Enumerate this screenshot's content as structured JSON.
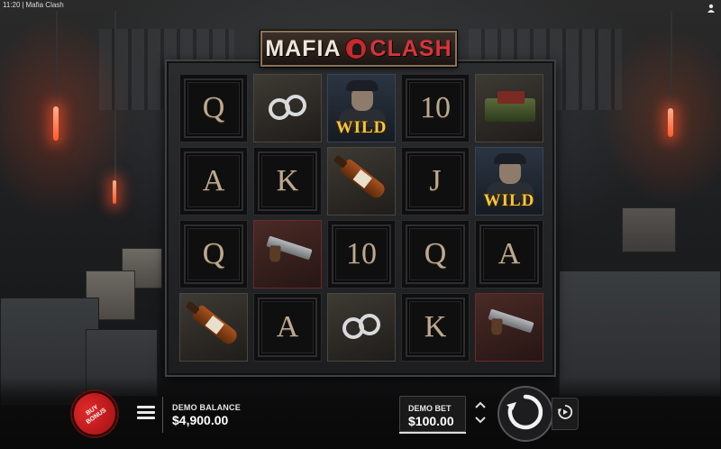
{
  "status_bar": {
    "time": "11:20",
    "separator": "|",
    "app_title": "Mafia Clash",
    "corner_icon": "game-settings-icon"
  },
  "logo": {
    "word_left": "MAFIA",
    "word_right": "CLASH",
    "emblem_icon": "mobster-badge-icon"
  },
  "reels": {
    "rows": [
      [
        {
          "type": "card",
          "label": "Q"
        },
        {
          "type": "symbol",
          "symbol": "handcuffs-icon"
        },
        {
          "type": "wild",
          "symbol": "mobster-icon",
          "label": "WILD"
        },
        {
          "type": "card",
          "label": "10"
        },
        {
          "type": "symbol",
          "symbol": "cash-stack-icon"
        }
      ],
      [
        {
          "type": "card",
          "label": "A"
        },
        {
          "type": "card",
          "label": "K"
        },
        {
          "type": "symbol",
          "symbol": "whiskey-bottle-icon"
        },
        {
          "type": "card",
          "label": "J"
        },
        {
          "type": "wild",
          "symbol": "mobster-icon",
          "label": "WILD"
        }
      ],
      [
        {
          "type": "card",
          "label": "Q"
        },
        {
          "type": "symbol",
          "symbol": "revolver-icon"
        },
        {
          "type": "card",
          "label": "10"
        },
        {
          "type": "card",
          "label": "Q"
        },
        {
          "type": "card",
          "label": "A"
        }
      ],
      [
        {
          "type": "symbol",
          "symbol": "whiskey-bottle-icon"
        },
        {
          "type": "card",
          "label": "A"
        },
        {
          "type": "symbol",
          "symbol": "handcuffs-icon"
        },
        {
          "type": "card",
          "label": "K"
        },
        {
          "type": "symbol",
          "symbol": "revolver-icon"
        }
      ]
    ]
  },
  "controls": {
    "buy_bonus_label": "BUY BONUS",
    "menu_icon": "hamburger-menu-icon",
    "balance_label": "DEMO BALANCE",
    "balance_value": "$4,900.00",
    "bet_label": "DEMO BET",
    "bet_value": "$100.00",
    "bet_up_icon": "chevron-up-icon",
    "bet_down_icon": "chevron-down-icon",
    "spin_icon": "spin-arrow-icon",
    "autoplay_icon": "autoplay-icon"
  }
}
